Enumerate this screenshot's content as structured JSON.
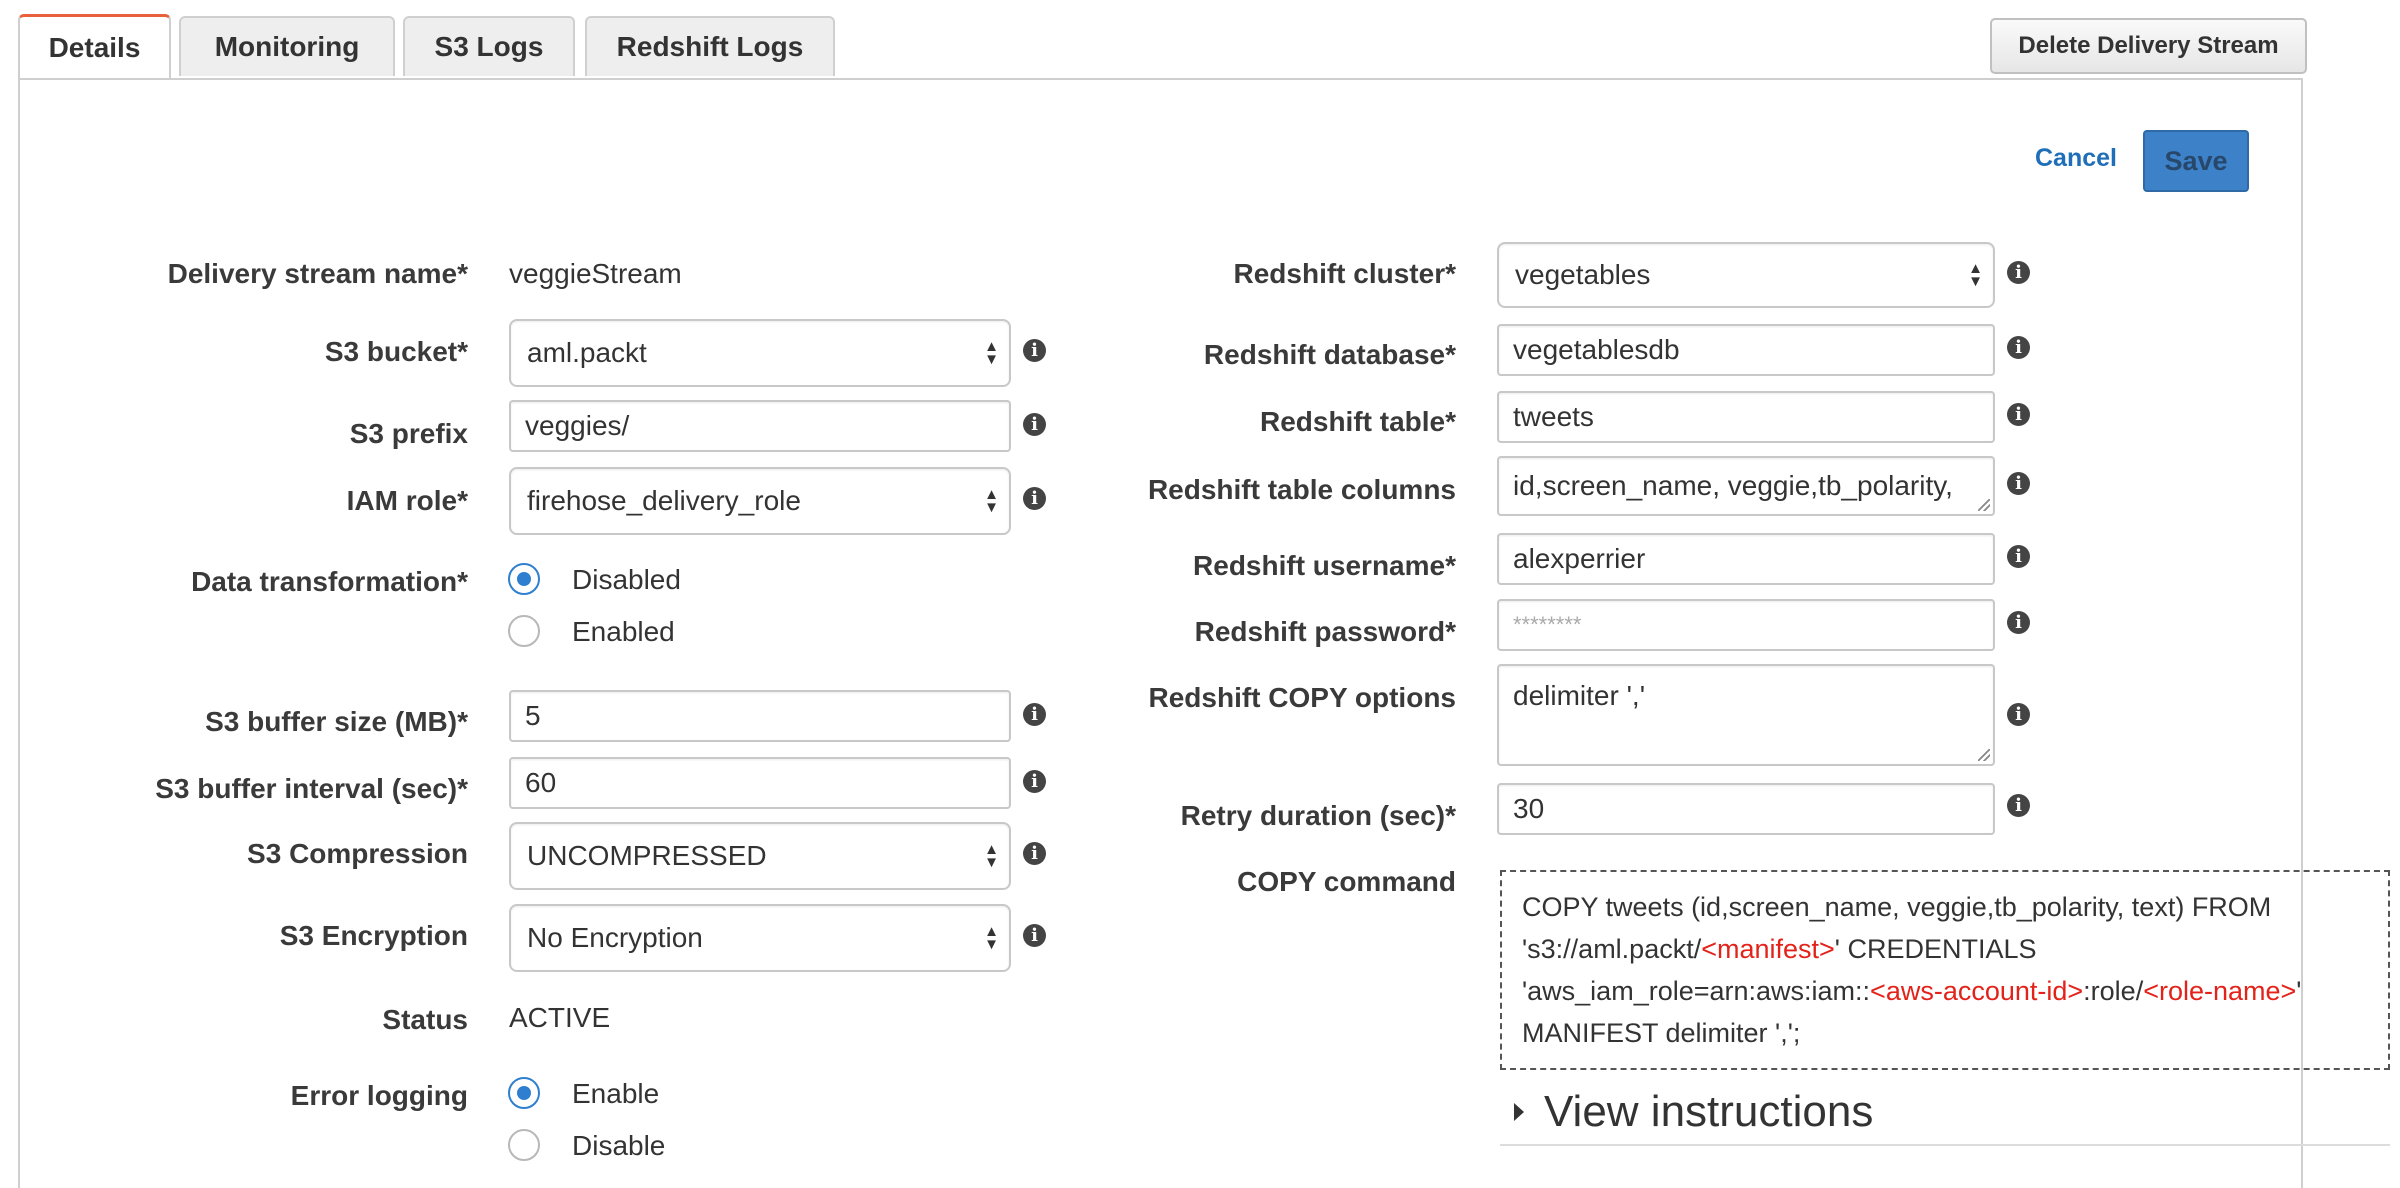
{
  "tabs": [
    {
      "label": "Details"
    },
    {
      "label": "Monitoring"
    },
    {
      "label": "S3 Logs"
    },
    {
      "label": "Redshift Logs"
    }
  ],
  "actions": {
    "delete_label": "Delete Delivery Stream",
    "cancel_label": "Cancel",
    "save_label": "Save"
  },
  "left": {
    "stream_name_label": "Delivery stream name*",
    "stream_name_value": "veggieStream",
    "s3_bucket_label": "S3 bucket*",
    "s3_bucket_value": "aml.packt",
    "s3_prefix_label": "S3 prefix",
    "s3_prefix_value": "veggies/",
    "iam_role_label": "IAM role*",
    "iam_role_value": "firehose_delivery_role",
    "transform_label": "Data transformation*",
    "transform_disabled": "Disabled",
    "transform_enabled": "Enabled",
    "transform_selected": "Disabled",
    "buffer_size_label": "S3 buffer size (MB)*",
    "buffer_size_value": "5",
    "buffer_interval_label": "S3 buffer interval (sec)*",
    "buffer_interval_value": "60",
    "compression_label": "S3 Compression",
    "compression_value": "UNCOMPRESSED",
    "encryption_label": "S3 Encryption",
    "encryption_value": "No Encryption",
    "status_label": "Status",
    "status_value": "ACTIVE",
    "error_logging_label": "Error logging",
    "error_enable": "Enable",
    "error_disable": "Disable",
    "error_selected": "Enable"
  },
  "right": {
    "cluster_label": "Redshift cluster*",
    "cluster_value": "vegetables",
    "database_label": "Redshift database*",
    "database_value": "vegetablesdb",
    "table_label": "Redshift table*",
    "table_value": "tweets",
    "columns_label": "Redshift table columns",
    "columns_value": "id,screen_name, veggie,tb_polarity,",
    "username_label": "Redshift username*",
    "username_value": "alexperrier",
    "password_label": "Redshift password*",
    "password_value": "********",
    "copy_options_label": "Redshift COPY options",
    "copy_options_value": "delimiter ','",
    "retry_label": "Retry duration (sec)*",
    "retry_value": "30",
    "copy_command_label": "COPY command",
    "copy_command": {
      "line1": "COPY tweets (id,screen_name, veggie,tb_polarity, text) FROM",
      "line2_a": "'s3://aml.packt/",
      "line2_red": "<manifest>",
      "line2_b": "' CREDENTIALS",
      "line3_a": "'aws_iam_role=arn:aws:iam::",
      "line3_red1": "<aws-account-id>",
      "line3_b": ":role/",
      "line3_red2": "<role-name>",
      "line3_c": "'",
      "line4": "MANIFEST delimiter ',';"
    },
    "view_instructions": "View instructions"
  },
  "colors": {
    "accent_tab": "#e8603c",
    "primary_button": "#3d82c9",
    "link": "#1f6fb8",
    "placeholder_red": "#e3231a",
    "radio": "#2f7fd0"
  }
}
